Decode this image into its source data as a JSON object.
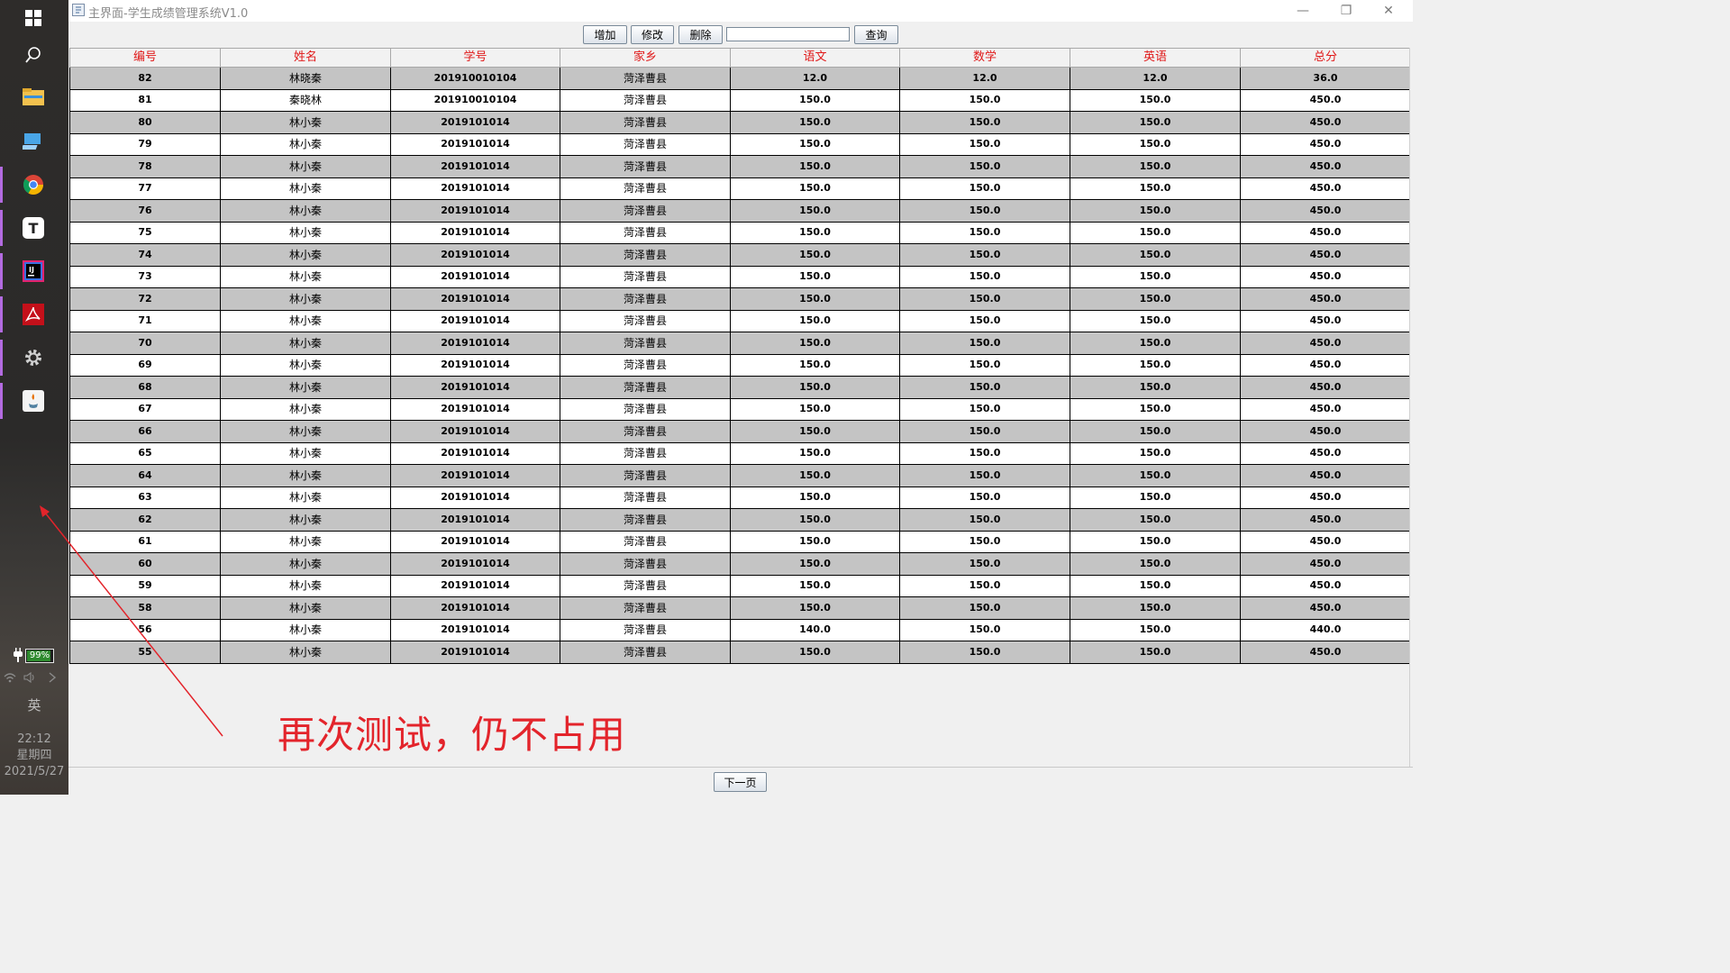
{
  "window": {
    "title": "主界面-学生成绩管理系统V1.0",
    "controls": {
      "minimize": "—",
      "restore": "❐",
      "close": "✕"
    }
  },
  "toolbar": {
    "add_label": "增加",
    "edit_label": "修改",
    "delete_label": "删除",
    "search_value": "",
    "query_label": "查询"
  },
  "table": {
    "columns": [
      "编号",
      "姓名",
      "学号",
      "家乡",
      "语文",
      "数学",
      "英语",
      "总分"
    ],
    "rows": [
      [
        "82",
        "林晓秦",
        "201910010104",
        "菏泽曹县",
        "12.0",
        "12.0",
        "12.0",
        "36.0"
      ],
      [
        "81",
        "秦晓林",
        "201910010104",
        "菏泽曹县",
        "150.0",
        "150.0",
        "150.0",
        "450.0"
      ],
      [
        "80",
        "林小秦",
        "2019101014",
        "菏泽曹县",
        "150.0",
        "150.0",
        "150.0",
        "450.0"
      ],
      [
        "79",
        "林小秦",
        "2019101014",
        "菏泽曹县",
        "150.0",
        "150.0",
        "150.0",
        "450.0"
      ],
      [
        "78",
        "林小秦",
        "2019101014",
        "菏泽曹县",
        "150.0",
        "150.0",
        "150.0",
        "450.0"
      ],
      [
        "77",
        "林小秦",
        "2019101014",
        "菏泽曹县",
        "150.0",
        "150.0",
        "150.0",
        "450.0"
      ],
      [
        "76",
        "林小秦",
        "2019101014",
        "菏泽曹县",
        "150.0",
        "150.0",
        "150.0",
        "450.0"
      ],
      [
        "75",
        "林小秦",
        "2019101014",
        "菏泽曹县",
        "150.0",
        "150.0",
        "150.0",
        "450.0"
      ],
      [
        "74",
        "林小秦",
        "2019101014",
        "菏泽曹县",
        "150.0",
        "150.0",
        "150.0",
        "450.0"
      ],
      [
        "73",
        "林小秦",
        "2019101014",
        "菏泽曹县",
        "150.0",
        "150.0",
        "150.0",
        "450.0"
      ],
      [
        "72",
        "林小秦",
        "2019101014",
        "菏泽曹县",
        "150.0",
        "150.0",
        "150.0",
        "450.0"
      ],
      [
        "71",
        "林小秦",
        "2019101014",
        "菏泽曹县",
        "150.0",
        "150.0",
        "150.0",
        "450.0"
      ],
      [
        "70",
        "林小秦",
        "2019101014",
        "菏泽曹县",
        "150.0",
        "150.0",
        "150.0",
        "450.0"
      ],
      [
        "69",
        "林小秦",
        "2019101014",
        "菏泽曹县",
        "150.0",
        "150.0",
        "150.0",
        "450.0"
      ],
      [
        "68",
        "林小秦",
        "2019101014",
        "菏泽曹县",
        "150.0",
        "150.0",
        "150.0",
        "450.0"
      ],
      [
        "67",
        "林小秦",
        "2019101014",
        "菏泽曹县",
        "150.0",
        "150.0",
        "150.0",
        "450.0"
      ],
      [
        "66",
        "林小秦",
        "2019101014",
        "菏泽曹县",
        "150.0",
        "150.0",
        "150.0",
        "450.0"
      ],
      [
        "65",
        "林小秦",
        "2019101014",
        "菏泽曹县",
        "150.0",
        "150.0",
        "150.0",
        "450.0"
      ],
      [
        "64",
        "林小秦",
        "2019101014",
        "菏泽曹县",
        "150.0",
        "150.0",
        "150.0",
        "450.0"
      ],
      [
        "63",
        "林小秦",
        "2019101014",
        "菏泽曹县",
        "150.0",
        "150.0",
        "150.0",
        "450.0"
      ],
      [
        "62",
        "林小秦",
        "2019101014",
        "菏泽曹县",
        "150.0",
        "150.0",
        "150.0",
        "450.0"
      ],
      [
        "61",
        "林小秦",
        "2019101014",
        "菏泽曹县",
        "150.0",
        "150.0",
        "150.0",
        "450.0"
      ],
      [
        "60",
        "林小秦",
        "2019101014",
        "菏泽曹县",
        "150.0",
        "150.0",
        "150.0",
        "450.0"
      ],
      [
        "59",
        "林小秦",
        "2019101014",
        "菏泽曹县",
        "150.0",
        "150.0",
        "150.0",
        "450.0"
      ],
      [
        "58",
        "林小秦",
        "2019101014",
        "菏泽曹县",
        "150.0",
        "150.0",
        "150.0",
        "450.0"
      ],
      [
        "56",
        "林小秦",
        "2019101014",
        "菏泽曹县",
        "140.0",
        "150.0",
        "150.0",
        "440.0"
      ],
      [
        "55",
        "林小秦",
        "2019101014",
        "菏泽曹县",
        "150.0",
        "150.0",
        "150.0",
        "450.0"
      ]
    ]
  },
  "pager": {
    "next_label": "下一页"
  },
  "annotation": {
    "text": "再次测试，仍不占用"
  },
  "taskbar": {
    "icons": [
      "windows-start-icon",
      "search-icon",
      "file-explorer-icon",
      "this-pc-icon",
      "chrome-icon",
      "typora-icon",
      "intellij-idea-icon",
      "acrobat-icon",
      "settings-gear-icon",
      "java-icon"
    ],
    "battery_percent": "99%",
    "ime_label": "英",
    "time": "22:12",
    "weekday": "星期四",
    "date": "2021/5/27"
  },
  "colors": {
    "header_text": "#e01818",
    "odd_row": "#c4c4c4",
    "even_row": "#ffffff",
    "annotation": "#e3242b",
    "taskbar_accent": "#b36be0"
  }
}
